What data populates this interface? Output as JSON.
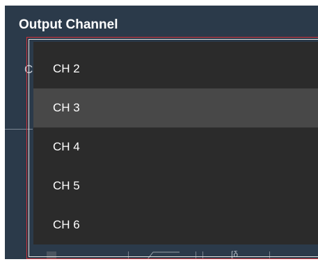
{
  "panel": {
    "title": "Output Channel",
    "partial_label": "C"
  },
  "dropdown": {
    "items": [
      {
        "label": "CH 2",
        "highlighted": false
      },
      {
        "label": "CH 3",
        "highlighted": true
      },
      {
        "label": "CH 4",
        "highlighted": false
      },
      {
        "label": "CH 5",
        "highlighted": false
      },
      {
        "label": "CH 6",
        "highlighted": false
      }
    ]
  },
  "colors": {
    "panel_bg": "#2b3a4a",
    "list_bg": "#2b2b2b",
    "hover_bg": "#484848",
    "focus_border": "#d0313a"
  }
}
